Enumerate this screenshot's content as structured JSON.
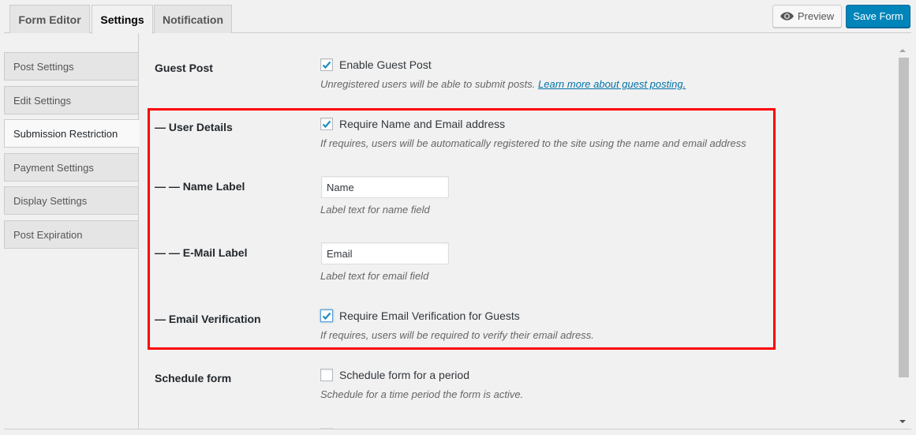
{
  "tabs": [
    {
      "label": "Form Editor",
      "active": false
    },
    {
      "label": "Settings",
      "active": true
    },
    {
      "label": "Notification",
      "active": false
    }
  ],
  "toolbar": {
    "preview_label": "Preview",
    "preview_icon": "eye-icon",
    "save_label": "Save Form",
    "save_color": "#0085ba"
  },
  "sidenav": {
    "items": [
      {
        "label": "Post Settings",
        "active": false
      },
      {
        "label": "Edit Settings",
        "active": false
      },
      {
        "label": "Submission Restriction",
        "active": true
      },
      {
        "label": "Payment Settings",
        "active": false
      },
      {
        "label": "Display Settings",
        "active": false
      },
      {
        "label": "Post Expiration",
        "active": false
      }
    ]
  },
  "settings": {
    "guest_post": {
      "label": "Guest Post",
      "checkbox_label": "Enable Guest Post",
      "checked": true,
      "description": "Unregistered users will be able to submit posts.",
      "link_text": "Learn more about guest posting."
    },
    "user_details": {
      "label": "— User Details",
      "checkbox_label": "Require Name and Email address",
      "checked": true,
      "description": "If requires, users will be automatically registered to the site using the name and email address"
    },
    "name_label": {
      "label": "— — Name Label",
      "value": "Name",
      "description": "Label text for name field"
    },
    "email_label": {
      "label": "— — E-Mail Label",
      "value": "Email",
      "description": "Label text for email field"
    },
    "email_verification": {
      "label": "— Email Verification",
      "checkbox_label": "Require Email Verification for Guests",
      "checked": true,
      "description": "If requires, users will be required to verify their email adress."
    },
    "schedule_form": {
      "label": "Schedule form",
      "checkbox_label": "Schedule form for a period",
      "checked": false,
      "description": "Schedule for a time period the form is active."
    }
  },
  "colors": {
    "highlight_border": "#ff0000",
    "link": "#0073aa",
    "check": "#1e8cbe"
  }
}
